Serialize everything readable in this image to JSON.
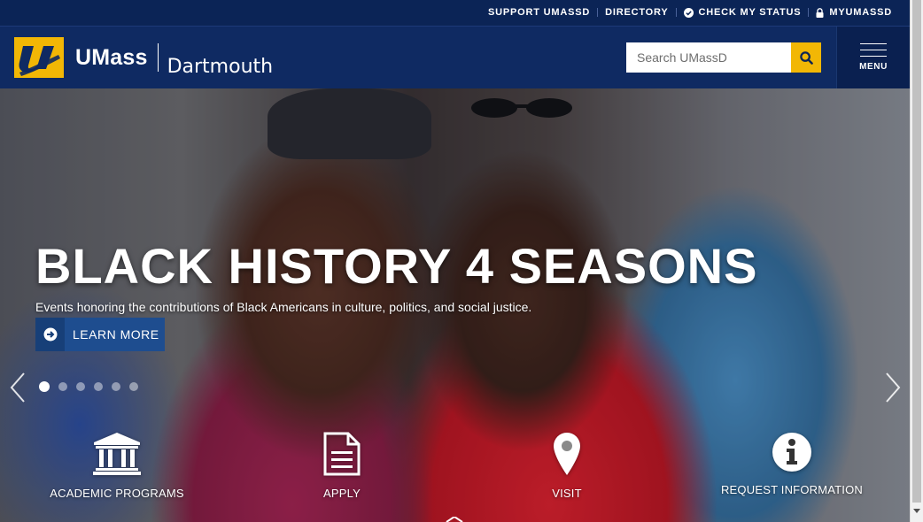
{
  "topbar": {
    "links": [
      {
        "label": "SUPPORT UMASSD",
        "icon": ""
      },
      {
        "label": "DIRECTORY",
        "icon": ""
      },
      {
        "label": "CHECK MY STATUS",
        "icon": "check-circle-icon"
      },
      {
        "label": "MYUMASSD",
        "icon": "lock-icon"
      }
    ]
  },
  "header": {
    "brand": "UMass",
    "campus": "Dartmouth",
    "search_placeholder": "Search UMassD",
    "menu_label": "MENU",
    "colors": {
      "navy": "#0f2a62",
      "gold": "#f2b705"
    }
  },
  "hero": {
    "title": "BLACK HISTORY 4 SEASONS",
    "subtitle": "Events honoring the contributions of Black Americans in culture, politics, and social justice.",
    "cta_label": "LEARN MORE",
    "slides_total": 6,
    "active_slide": 1
  },
  "quicklinks": [
    {
      "label": "ACADEMIC PROGRAMS",
      "icon": "institution-icon"
    },
    {
      "label": "APPLY",
      "icon": "document-icon"
    },
    {
      "label": "VISIT",
      "icon": "map-pin-icon"
    },
    {
      "label": "REQUEST INFORMATION",
      "icon": "info-icon"
    }
  ]
}
